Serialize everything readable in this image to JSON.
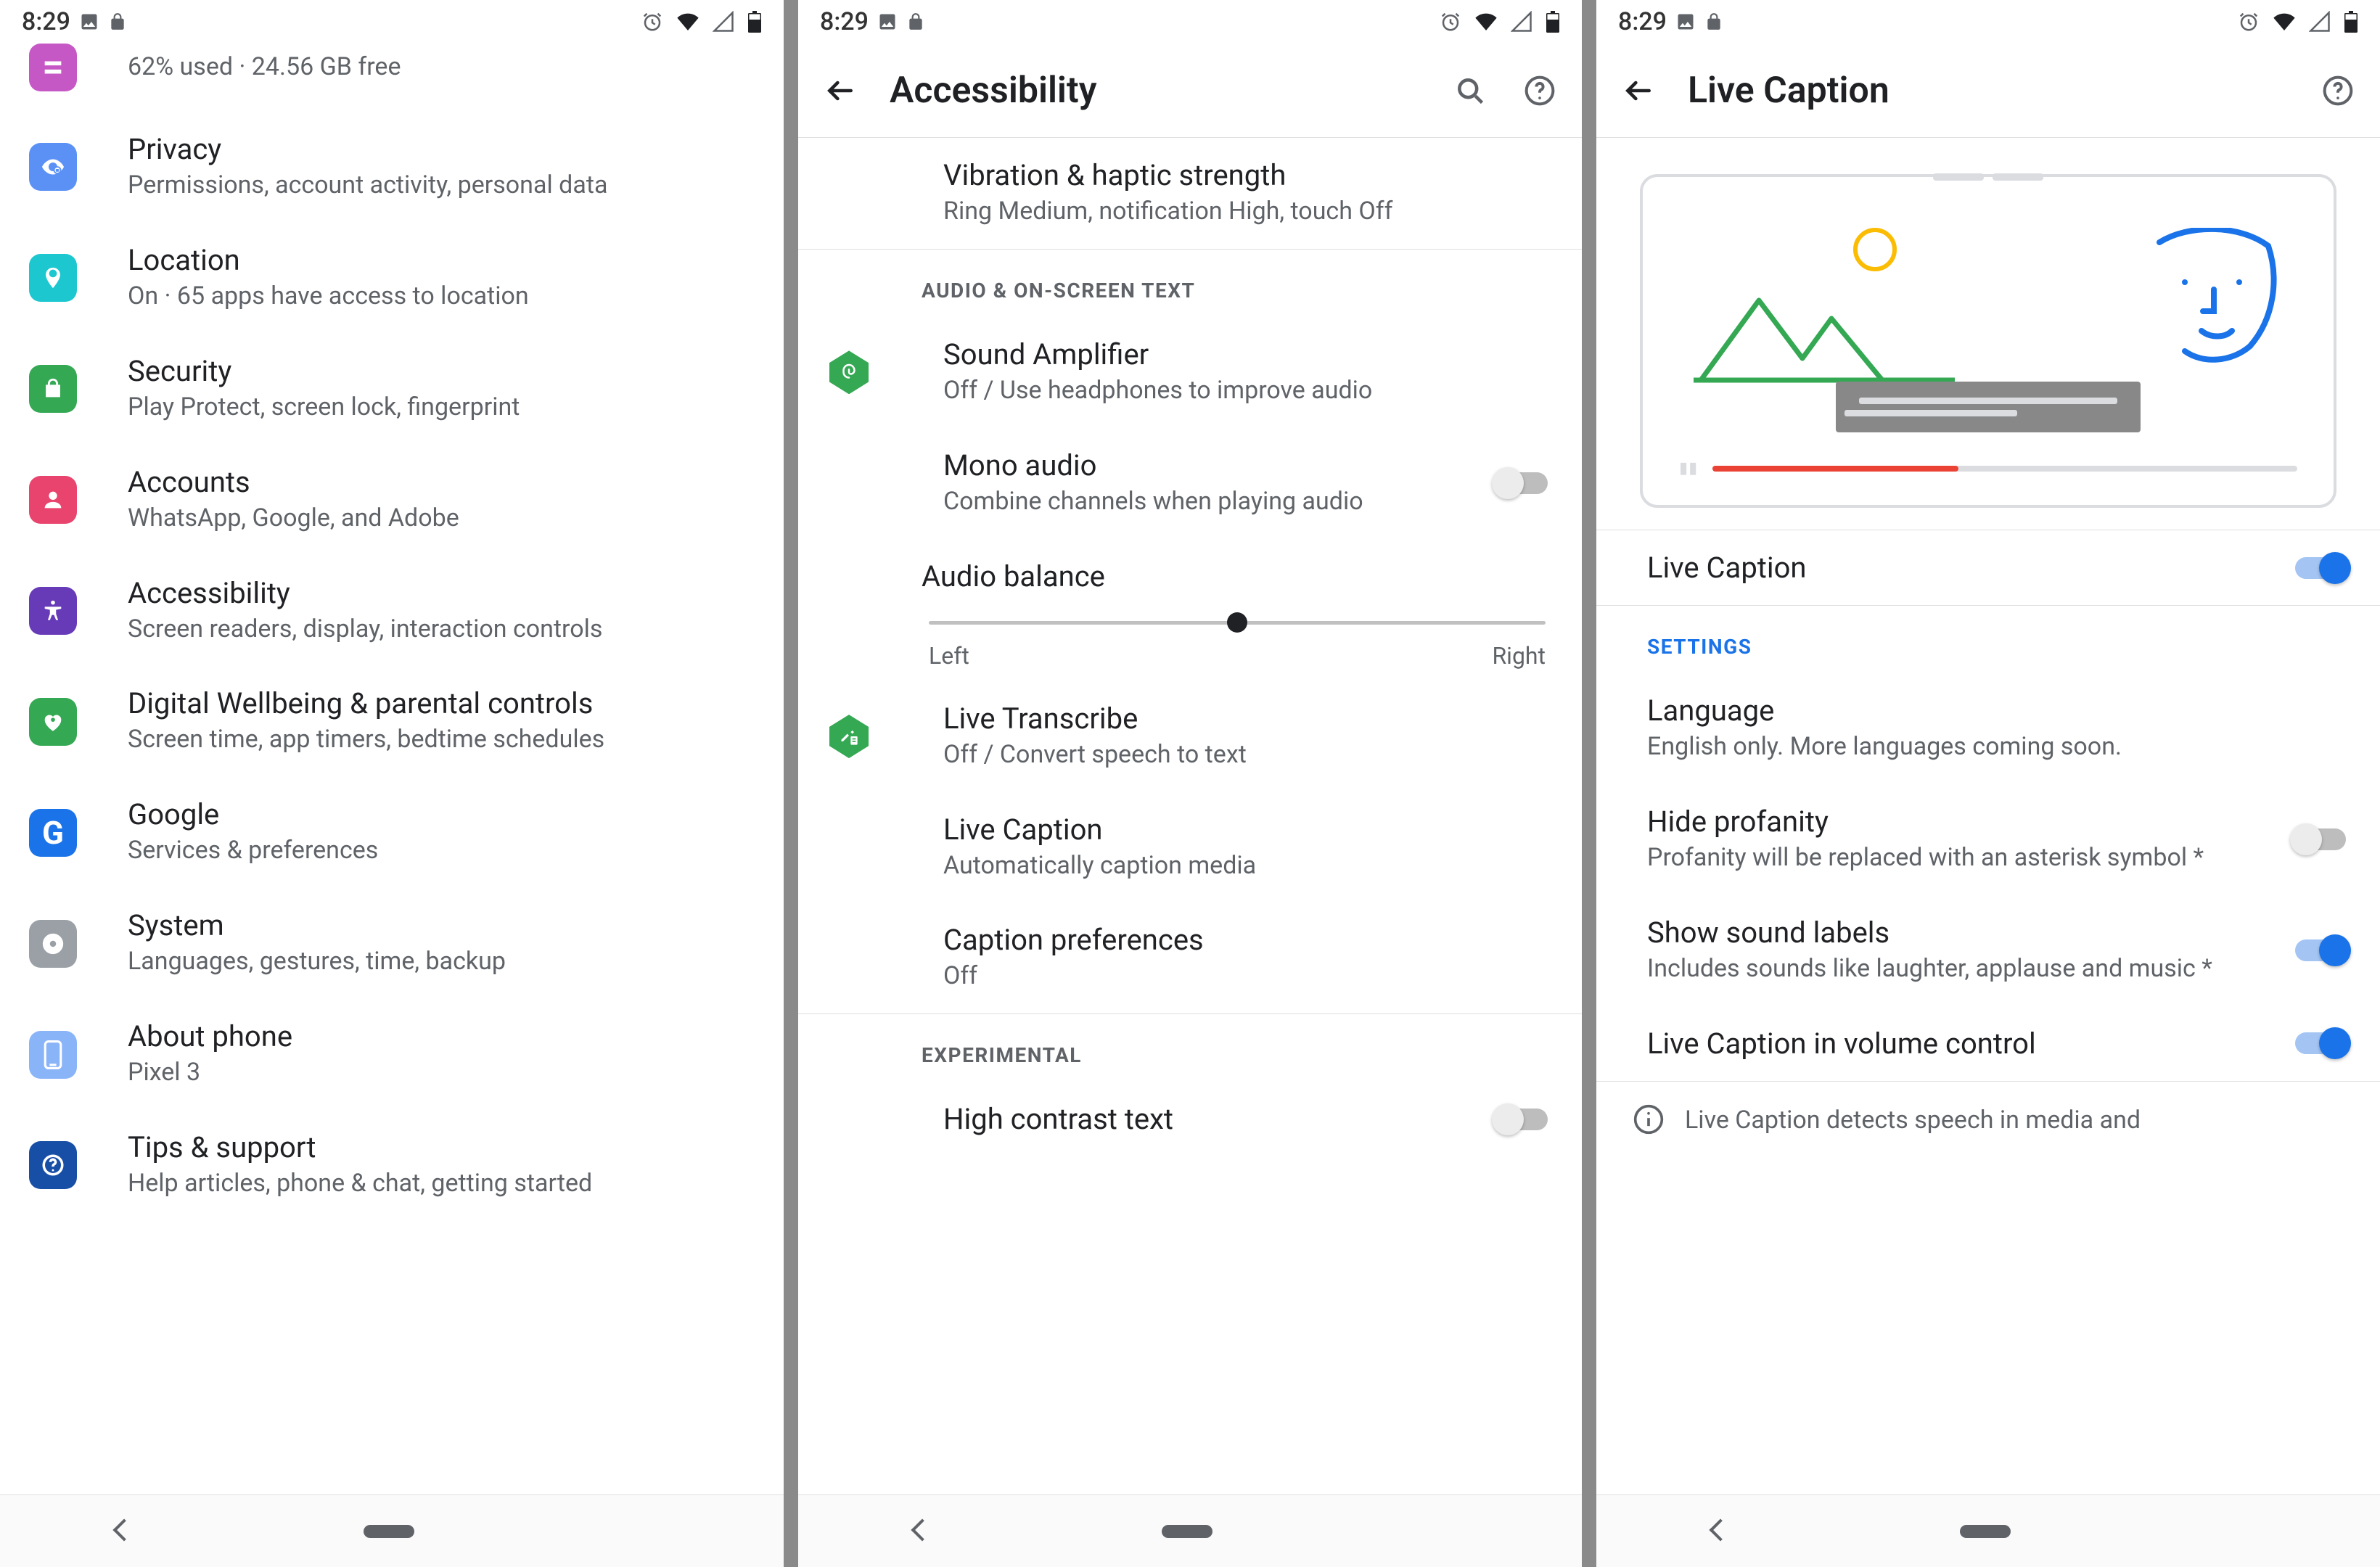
{
  "status": {
    "time": "8:29",
    "icons_left": [
      "image-icon",
      "lock-icon"
    ],
    "icons_right": [
      "alarm-icon",
      "wifi-icon",
      "signal-icon",
      "battery-icon"
    ]
  },
  "settings_panel": {
    "storage_sub": "62% used · 24.56 GB free",
    "rows": [
      {
        "icon_color": "#5b91f5",
        "svg": "eye",
        "title": "Privacy",
        "sub": "Permissions, account activity, personal data"
      },
      {
        "icon_color": "#1cc7d0",
        "svg": "pin",
        "title": "Location",
        "sub": "On · 65 apps have access to location"
      },
      {
        "icon_color": "#34a853",
        "svg": "lock",
        "title": "Security",
        "sub": "Play Protect, screen lock, fingerprint"
      },
      {
        "icon_color": "#e8446d",
        "svg": "person",
        "title": "Accounts",
        "sub": "WhatsApp, Google, and Adobe"
      },
      {
        "icon_color": "#673ab7",
        "svg": "a11y",
        "title": "Accessibility",
        "sub": "Screen readers, display, interaction controls"
      },
      {
        "icon_color": "#34a853",
        "svg": "heart",
        "title": "Digital Wellbeing & parental controls",
        "sub": "Screen time, app timers, bedtime schedules"
      },
      {
        "icon_color": "#1a73e8",
        "svg": "g",
        "title": "Google",
        "sub": "Services & preferences"
      },
      {
        "icon_color": "#9aa0a6",
        "svg": "info",
        "title": "System",
        "sub": "Languages, gestures, time, backup"
      },
      {
        "icon_color": "#8ab4f8",
        "svg": "phone",
        "title": "About phone",
        "sub": "Pixel 3"
      },
      {
        "icon_color": "#174ea6",
        "svg": "help",
        "title": "Tips & support",
        "sub": "Help articles, phone & chat, getting started"
      }
    ]
  },
  "accessibility_panel": {
    "title": "Accessibility",
    "vibration": {
      "title": "Vibration & haptic strength",
      "sub": "Ring Medium, notification High, touch Off"
    },
    "section_audio": "AUDIO & ON-SCREEN TEXT",
    "sound_amp": {
      "title": "Sound Amplifier",
      "sub": "Off / Use headphones to improve audio"
    },
    "mono": {
      "title": "Mono audio",
      "sub": "Combine channels when playing audio",
      "on": false
    },
    "balance": {
      "title": "Audio balance",
      "left": "Left",
      "right": "Right"
    },
    "live_transcribe": {
      "title": "Live Transcribe",
      "sub": "Off / Convert speech to text"
    },
    "live_caption": {
      "title": "Live Caption",
      "sub": "Automatically caption media"
    },
    "caption_pref": {
      "title": "Caption preferences",
      "sub": "Off"
    },
    "section_exp": "EXPERIMENTAL",
    "high_contrast": {
      "title": "High contrast text",
      "on": false
    }
  },
  "livecaption_panel": {
    "title": "Live Caption",
    "master": {
      "title": "Live Caption",
      "on": true
    },
    "section": "SETTINGS",
    "language": {
      "title": "Language",
      "sub": "English only. More languages coming soon."
    },
    "profanity": {
      "title": "Hide profanity",
      "sub": "Profanity will be replaced with an asterisk symbol *",
      "on": false
    },
    "soundlabels": {
      "title": "Show sound labels",
      "sub": "Includes sounds like laughter, applause and music *",
      "on": true
    },
    "volctl": {
      "title": "Live Caption in volume control",
      "on": true
    },
    "info": "Live Caption detects speech in media and"
  }
}
